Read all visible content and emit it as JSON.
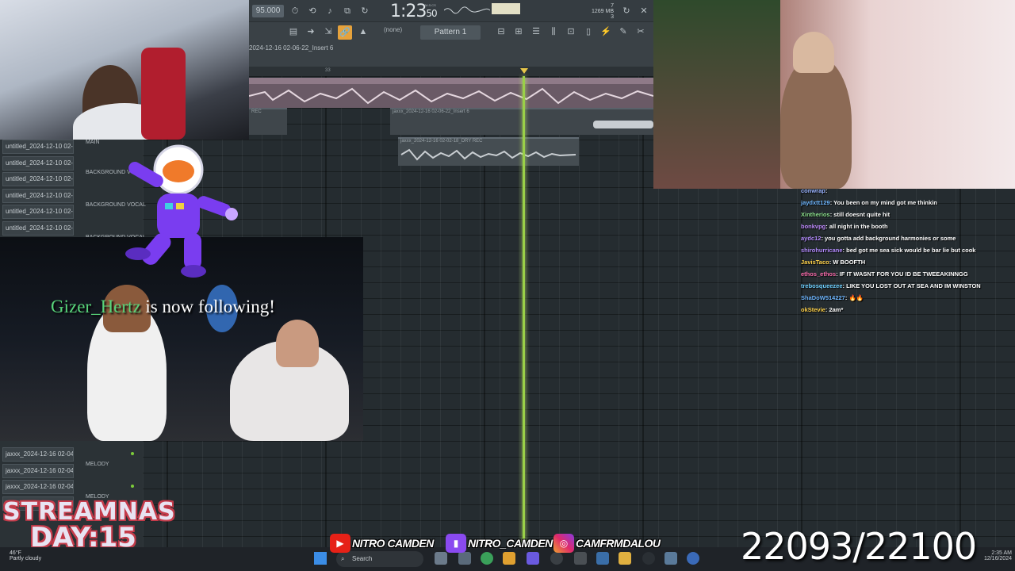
{
  "daw": {
    "tempo": "95.000",
    "time_main": "1:23",
    "time_small": "50",
    "time_unit": "M:S:CS",
    "memory": "1269 MB",
    "memory_small": "3",
    "memory_top": "7",
    "pattern": "Pattern 1",
    "none_label": "(none)",
    "insert_title": "2024-12-16 02-06-22_Insert 6",
    "ruler_mark": "33",
    "clip0_title": "REC",
    "clip2_title": "jaxxx_2024-12-16 02-06-22_Insert 6",
    "clip3_title": "jaxxx_2024-12-16 02-02-18_DRY REC",
    "track_main": "MAIN",
    "tracks_top": [
      {
        "clip": "untitled_2024-12-10 02-",
        "name": "BACKGROUND VOCAL"
      },
      {
        "clip": "untitled_2024-12-10 02-",
        "name": ""
      },
      {
        "clip": "untitled_2024-12-10 02-",
        "name": "BACKGROUND VOCAL"
      },
      {
        "clip": "untitled_2024-12-10 02-",
        "name": ""
      },
      {
        "clip": "untitled_2024-12-10 02-",
        "name": "BACKGROUND VOCAL"
      },
      {
        "clip": "untitled_2024-12-10 02-",
        "name": ""
      }
    ],
    "tracks_bottom": [
      {
        "clip": "jaxxx_2024-12-16 02-04-",
        "name": "MELODY"
      },
      {
        "clip": "jaxxx_2024-12-16 02-04-",
        "name": ""
      },
      {
        "clip": "jaxxx_2024-12-16 02-04-",
        "name": "MELODY"
      },
      {
        "clip": "jaxxx_2024",
        "name": ""
      }
    ]
  },
  "alert": {
    "follower": "Gizer_Hertz",
    "text": " is now following!"
  },
  "chat": [
    {
      "user": "conwrap",
      "color": "#9ab3ff",
      "text": ""
    },
    {
      "user": "jaydxtt129",
      "color": "#6fb7ff",
      "text": "You been on my mind got me thinkin"
    },
    {
      "user": "Xintherios",
      "color": "#8ce08c",
      "text": "still doesnt quite hit"
    },
    {
      "user": "bonkvpg",
      "color": "#c18cff",
      "text": "all night in the booth"
    },
    {
      "user": "aydc12",
      "color": "#b48cff",
      "text": "you gotta add background harmonies or some"
    },
    {
      "user": "shirohurricane",
      "color": "#b48cff",
      "text": "bed got me sea sick would be bar lie but cook"
    },
    {
      "user": "JavisTaco",
      "color": "#ffd24a",
      "text": "W BOOFTH"
    },
    {
      "user": "ethos_ethos",
      "color": "#ff6fb0",
      "text": "IF IT WASNT FOR YOU ID BE TWEEAKINNGG"
    },
    {
      "user": "trebosqueezee",
      "color": "#6fd0ff",
      "text": "LIKE YOU LOST OUT AT SEA AND IM WINSTON"
    },
    {
      "user": "ShaDoW514227",
      "color": "#6fb7ff",
      "text": "🔥🔥"
    },
    {
      "user": "okStevie",
      "color": "#ffd24a",
      "text": "2am*"
    }
  ],
  "socials": {
    "youtube": "NITRO CAMDEN",
    "twitch": "NITRO_CAMDEN",
    "instagram": "CAMFRMDALOU"
  },
  "counter": "22093/22100",
  "stream_logo": {
    "line1": "STREAMNAS",
    "line2": "DAY:15"
  },
  "taskbar": {
    "weather_temp": "46°F",
    "weather_desc": "Partly cloudy",
    "search": "Search",
    "time": "2:35 AM",
    "date": "12/16/2024"
  },
  "colors": {
    "playhead": "#9ad048",
    "accent": "#e6a23c",
    "follow_name": "#58d47a"
  }
}
